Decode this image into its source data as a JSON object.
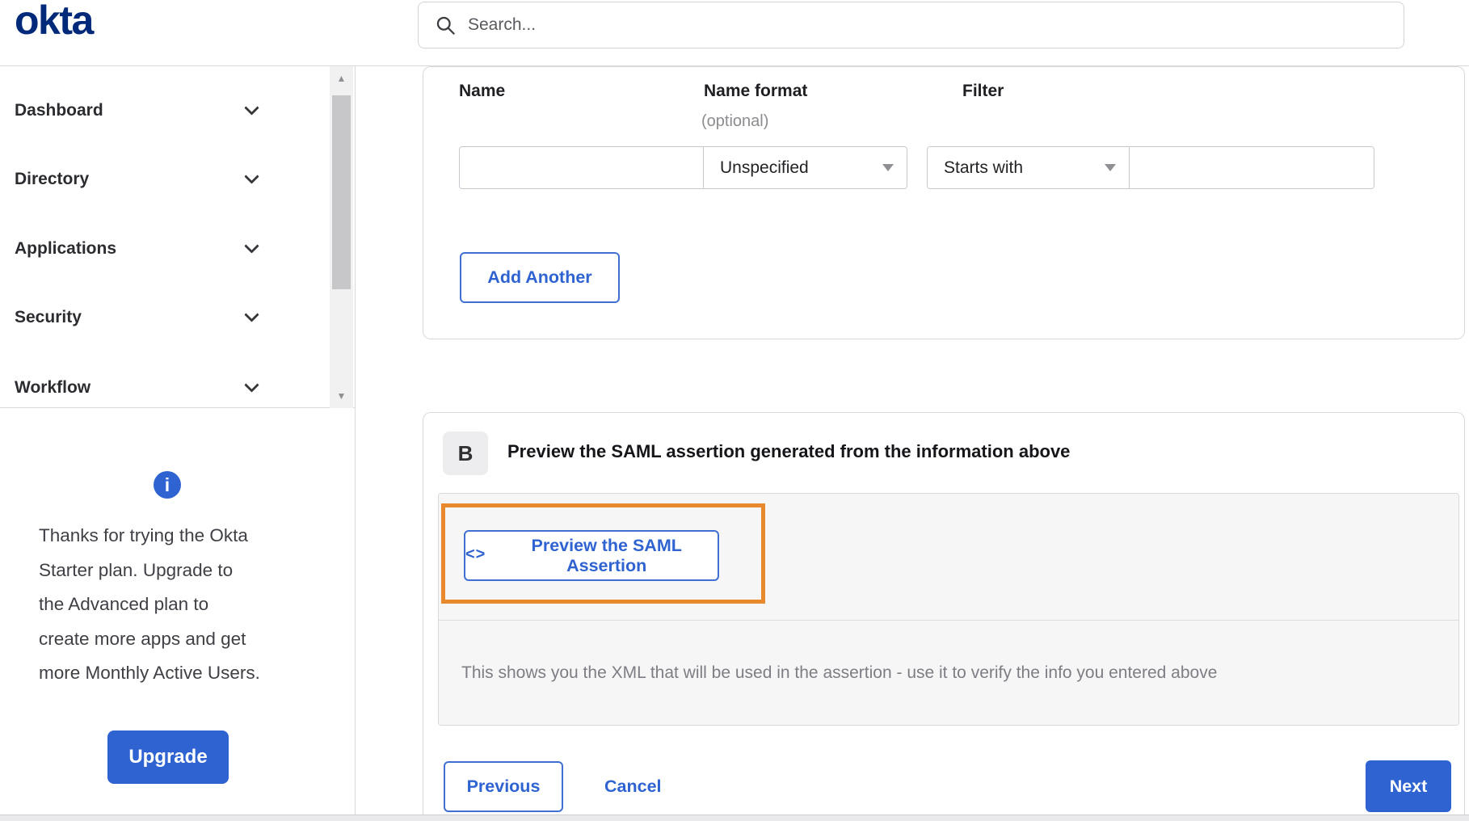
{
  "header": {
    "logo_text": "okta",
    "search_placeholder": "Search..."
  },
  "sidebar": {
    "items": [
      {
        "label": "Dashboard"
      },
      {
        "label": "Directory"
      },
      {
        "label": "Applications"
      },
      {
        "label": "Security"
      },
      {
        "label": "Workflow"
      }
    ],
    "promo": {
      "lines": [
        "Thanks for trying the Okta",
        "Starter plan. Upgrade to",
        "the Advanced plan to",
        "create more apps and get",
        "more Monthly Active Users."
      ],
      "upgrade_label": "Upgrade"
    }
  },
  "attribute_form": {
    "name_label": "Name",
    "name_format_label": "Name format",
    "name_format_optional": "(optional)",
    "filter_label": "Filter",
    "name_value": "",
    "name_format_value": "Unspecified",
    "filter_operator_value": "Starts with",
    "filter_value": "",
    "add_another_label": "Add Another"
  },
  "preview_section": {
    "step_badge": "B",
    "title": "Preview the SAML assertion generated from the information above",
    "preview_button_icon": "<>",
    "preview_button_label": "Preview the SAML Assertion",
    "description": "This shows you the XML that will be used in the assertion - use it to verify the info you entered above"
  },
  "footer_actions": {
    "previous_label": "Previous",
    "cancel_label": "Cancel",
    "next_label": "Next"
  },
  "colors": {
    "accent_blue": "#2e63d1",
    "logo_navy": "#00297a",
    "annotation_orange": "#e8892d"
  }
}
